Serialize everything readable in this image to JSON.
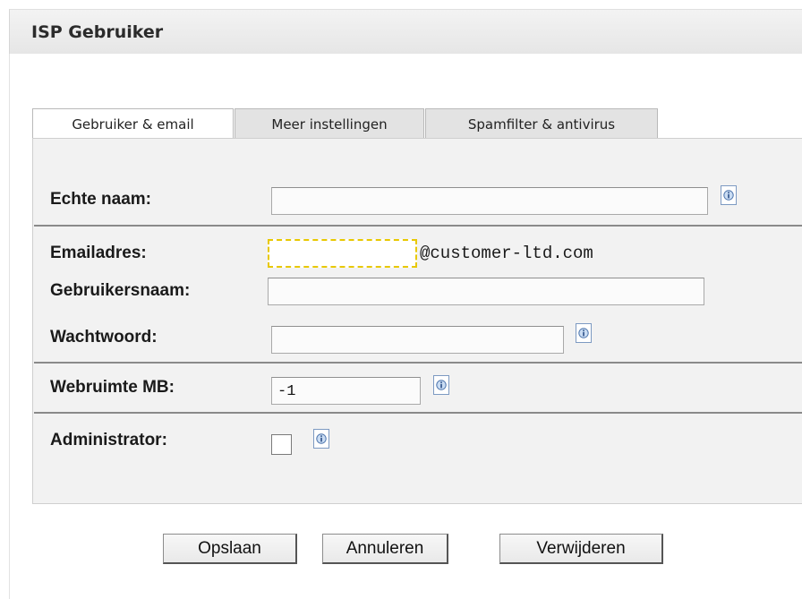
{
  "panel": {
    "title": "ISP Gebruiker"
  },
  "tabs": [
    {
      "label": "Gebruiker & email",
      "active": true
    },
    {
      "label": "Meer instellingen",
      "active": false
    },
    {
      "label": "Spamfilter & antivirus",
      "active": false
    }
  ],
  "form": {
    "real_name": {
      "label": "Echte naam:",
      "value": ""
    },
    "email": {
      "label": "Emailadres:",
      "value": "",
      "domain_suffix": "@customer-ltd.com"
    },
    "username": {
      "label": "Gebruikersnaam:",
      "value": ""
    },
    "password": {
      "label": "Wachtwoord:",
      "value": ""
    },
    "webspace": {
      "label": "Webruimte MB:",
      "value": "-1"
    },
    "administrator": {
      "label": "Administrator:",
      "checked": false
    }
  },
  "buttons": {
    "save": "Opslaan",
    "cancel": "Annuleren",
    "delete": "Verwijderen"
  },
  "icons": {
    "info": "info-icon"
  },
  "colors": {
    "focus_border": "#e8c800",
    "form_background": "#f2f2f2"
  }
}
